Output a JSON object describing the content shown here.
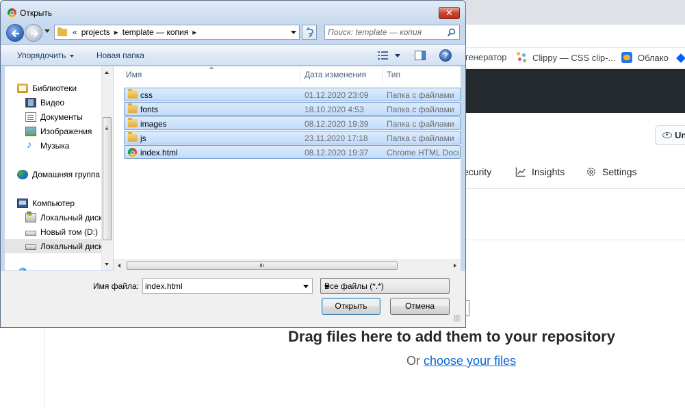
{
  "dialog": {
    "title": "Открыть",
    "nav": {
      "breadcrumb": [
        "projects",
        "template — копия"
      ],
      "overflow": "«",
      "search_placeholder": "Поиск: template — копия"
    },
    "command_bar": {
      "organize": "Упорядочить",
      "new_folder": "Новая папка"
    },
    "sidebar": {
      "items": [
        {
          "label": "Библиотеки",
          "icon": "library-icon"
        },
        {
          "label": "Видео",
          "icon": "video-icon"
        },
        {
          "label": "Документы",
          "icon": "documents-icon"
        },
        {
          "label": "Изображения",
          "icon": "pictures-icon"
        },
        {
          "label": "Музыка",
          "icon": "music-icon"
        },
        {
          "label": "Домашняя группа",
          "icon": "homegroup-icon"
        },
        {
          "label": "Компьютер",
          "icon": "computer-icon"
        },
        {
          "label": "Локальный диск (C:)",
          "icon": "windows-disk-icon"
        },
        {
          "label": "Новый том (D:)",
          "icon": "disk-icon"
        },
        {
          "label": "Локальный диск (E:)",
          "icon": "disk-icon"
        }
      ],
      "selected_index": 9
    },
    "columns": {
      "name": "Имя",
      "date": "Дата изменения",
      "type": "Тип"
    },
    "files": [
      {
        "name": "css",
        "date": "01.12.2020 23:09",
        "type": "Папка с файлами",
        "icon": "folder-icon"
      },
      {
        "name": "fonts",
        "date": "18.10.2020 4:53",
        "type": "Папка с файлами",
        "icon": "folder-icon"
      },
      {
        "name": "images",
        "date": "08.12.2020 19:39",
        "type": "Папка с файлами",
        "icon": "folder-icon"
      },
      {
        "name": "js",
        "date": "23.11.2020 17:18",
        "type": "Папка с файлами",
        "icon": "folder-icon"
      },
      {
        "name": "index.html",
        "date": "08.12.2020 19:37",
        "type": "Chrome HTML Document",
        "icon": "chrome-icon"
      }
    ],
    "filename_label": "Имя файла:",
    "filename_value": "index.html",
    "filter_value": "Все файлы (*.*)",
    "open_button": "Открыть",
    "cancel_button": "Отмена",
    "close_symbol": "✕"
  },
  "browser": {
    "bookmarks": [
      "генератор",
      "Clippy — CSS clip-...",
      "Облако"
    ],
    "repo_tabs": [
      "ecurity",
      "Insights",
      "Settings"
    ],
    "watch_button": "Un",
    "drop_heading": "Drag files here to add them to your repository",
    "drop_or": "Or",
    "drop_link": "choose your files"
  },
  "colors": {
    "github_header": "#24292e",
    "link": "#0366d6",
    "selection_fill": "#c1dcfc",
    "selection_border": "#7da2ce"
  }
}
